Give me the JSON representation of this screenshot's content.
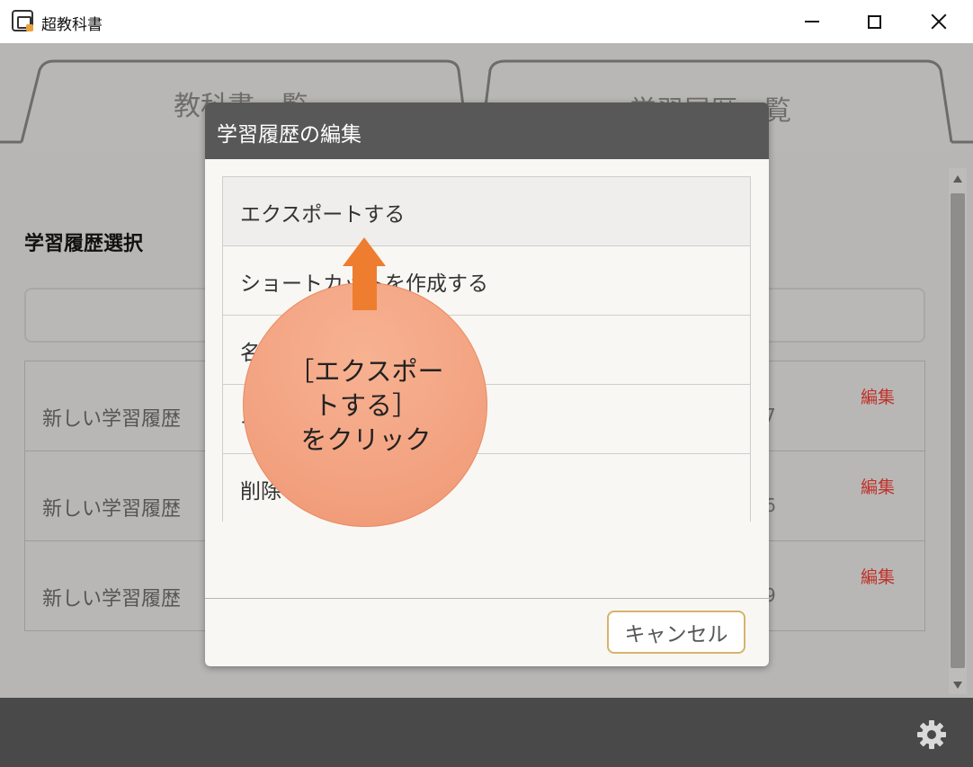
{
  "window": {
    "title": "超教科書",
    "minimize_icon": "minimize-icon",
    "maximize_icon": "maximize-icon",
    "close_icon": "close-icon"
  },
  "tabs": [
    {
      "label": "教科書一覧"
    },
    {
      "label": "学習履歴一覧"
    }
  ],
  "section_title": "学習履歴選択",
  "history_rows": [
    {
      "name": "新しい学習履歴",
      "date_suffix": "7",
      "edit": "編集"
    },
    {
      "name": "新しい学習履歴",
      "date_suffix": "6",
      "edit": "編集"
    },
    {
      "name": "新しい学習履歴",
      "date_suffix": "9",
      "edit": "編集"
    }
  ],
  "dialog": {
    "title": "学習履歴の編集",
    "items": [
      {
        "label": "エクスポートする"
      },
      {
        "label": "ショートカットを作成する"
      },
      {
        "label": "名"
      },
      {
        "label": "イ"
      },
      {
        "label": "削除"
      }
    ],
    "cancel_label": "キャンセル"
  },
  "callout": {
    "line1": "［エクスポー",
    "line2": "トする］",
    "line3": "をクリック"
  },
  "colors": {
    "accent_orange": "#ee7d2f",
    "edit_red": "#c0312b",
    "dialog_header": "#585858"
  }
}
